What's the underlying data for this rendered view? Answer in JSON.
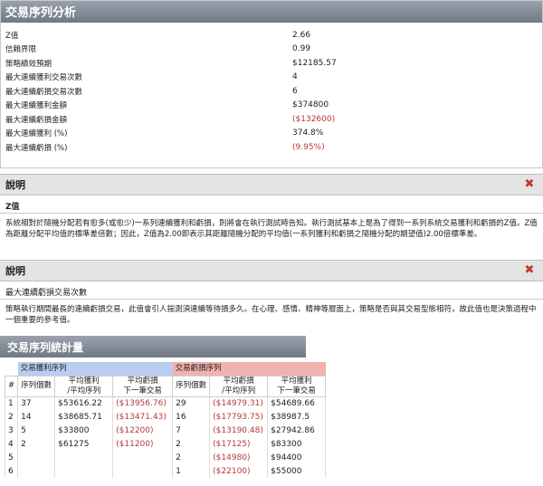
{
  "analysis": {
    "title": "交易序列分析",
    "rows": [
      {
        "label": "Z值",
        "value": "2.66",
        "negative": false
      },
      {
        "label": "信賴界限",
        "value": "0.99",
        "negative": false
      },
      {
        "label": "策略績效預期",
        "value": "$12185.57",
        "negative": false
      },
      {
        "label": "最大連續獲利交易次數",
        "value": "4",
        "negative": false
      },
      {
        "label": "最大連續虧損交易次數",
        "value": "6",
        "negative": false
      },
      {
        "label": "最大連續獲利金額",
        "value": "$374800",
        "negative": false
      },
      {
        "label": "最大連續虧損金額",
        "value": "($132600)",
        "negative": true
      },
      {
        "label": "最大連續獲利 (%)",
        "value": "374.8%",
        "negative": false
      },
      {
        "label": "最大連續虧損 (%)",
        "value": "(9.95%)",
        "negative": true
      }
    ]
  },
  "explain1": {
    "title": "說明",
    "term": "Z值",
    "text": "系統相對於隨機分配若有愈多(或愈少)一系列連續獲利和虧損，則將會在執行測試時告知。執行測試基本上是為了得到一系列系統交易獲利和虧損的Z值。Z值為距離分配平均值的標準差倍數；因此，Z值為2.00即表示其距離隨機分配的平均值(一系列獲利和虧損之隨機分配的期望值)2.00倍標準差。"
  },
  "explain2": {
    "title": "說明",
    "term": "最大連續虧損交易次數",
    "text": "策略執行期間最長的連續虧損交易，此值會引人揣測須連續等待損多久。在心理、感情、精神等層面上，策略是否與其交易型態相符，故此值也是決策過程中一個重要的參考值。"
  },
  "table": {
    "title": "交易序列統計量",
    "group_win": "交易獲利序列",
    "group_loss": "交易虧損序列",
    "headers": [
      "#",
      "序列個數",
      "平均獲利\n/平均序列",
      "平均虧損\n下一筆交易",
      "序列個數",
      "平均虧損\n/平均序列",
      "平均獲利\n下一筆交易"
    ],
    "rows": [
      {
        "n": "1",
        "wc": "37",
        "wavg": "$53616.22",
        "wnext": "($13956.76)",
        "lc": "29",
        "lavg": "($14979.31)",
        "lnext": "$54689.66"
      },
      {
        "n": "2",
        "wc": "14",
        "wavg": "$38685.71",
        "wnext": "($13471.43)",
        "lc": "16",
        "lavg": "($17793.75)",
        "lnext": "$38987.5"
      },
      {
        "n": "3",
        "wc": "5",
        "wavg": "$33800",
        "wnext": "($12200)",
        "lc": "7",
        "lavg": "($13190.48)",
        "lnext": "$27942.86"
      },
      {
        "n": "4",
        "wc": "2",
        "wavg": "$61275",
        "wnext": "($11200)",
        "lc": "2",
        "lavg": "($17125)",
        "lnext": "$83300"
      },
      {
        "n": "5",
        "wc": "",
        "wavg": "",
        "wnext": "",
        "lc": "2",
        "lavg": "($14980)",
        "lnext": "$94400"
      },
      {
        "n": "6",
        "wc": "",
        "wavg": "",
        "wnext": "",
        "lc": "1",
        "lavg": "($22100)",
        "lnext": "$55000"
      }
    ]
  },
  "colors": {
    "negative": "#b43a3a",
    "win_group": "#b9cdf2",
    "loss_group": "#f2b2ad",
    "close": "#c0392b"
  }
}
